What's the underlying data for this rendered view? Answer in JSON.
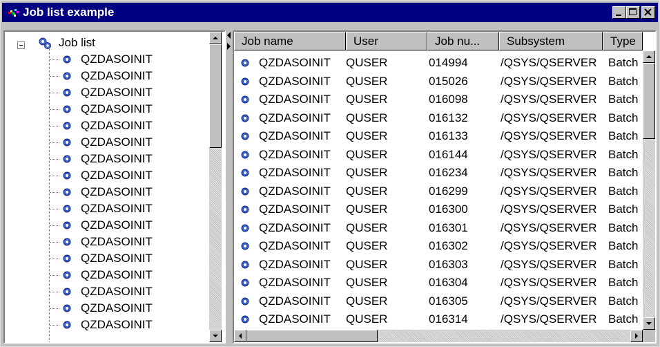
{
  "window": {
    "title": "Job list example",
    "title_bar_color": "#000080"
  },
  "title_buttons": [
    "minimize",
    "maximize",
    "close"
  ],
  "tree": {
    "root_label": "Job list",
    "items": [
      "QZDASOINIT",
      "QZDASOINIT",
      "QZDASOINIT",
      "QZDASOINIT",
      "QZDASOINIT",
      "QZDASOINIT",
      "QZDASOINIT",
      "QZDASOINIT",
      "QZDASOINIT",
      "QZDASOINIT",
      "QZDASOINIT",
      "QZDASOINIT",
      "QZDASOINIT",
      "QZDASOINIT",
      "QZDASOINIT",
      "QZDASOINIT",
      "QZDASOINIT"
    ]
  },
  "table": {
    "columns": [
      "Job name",
      "User",
      "Job nu...",
      "Subsystem",
      "Type"
    ],
    "rows": [
      [
        "QZDASOINIT",
        "QUSER",
        "014994",
        "/QSYS/QSERVER",
        "Batch"
      ],
      [
        "QZDASOINIT",
        "QUSER",
        "015026",
        "/QSYS/QSERVER",
        "Batch"
      ],
      [
        "QZDASOINIT",
        "QUSER",
        "016098",
        "/QSYS/QSERVER",
        "Batch"
      ],
      [
        "QZDASOINIT",
        "QUSER",
        "016132",
        "/QSYS/QSERVER",
        "Batch"
      ],
      [
        "QZDASOINIT",
        "QUSER",
        "016133",
        "/QSYS/QSERVER",
        "Batch"
      ],
      [
        "QZDASOINIT",
        "QUSER",
        "016144",
        "/QSYS/QSERVER",
        "Batch"
      ],
      [
        "QZDASOINIT",
        "QUSER",
        "016234",
        "/QSYS/QSERVER",
        "Batch"
      ],
      [
        "QZDASOINIT",
        "QUSER",
        "016299",
        "/QSYS/QSERVER",
        "Batch"
      ],
      [
        "QZDASOINIT",
        "QUSER",
        "016300",
        "/QSYS/QSERVER",
        "Batch"
      ],
      [
        "QZDASOINIT",
        "QUSER",
        "016301",
        "/QSYS/QSERVER",
        "Batch"
      ],
      [
        "QZDASOINIT",
        "QUSER",
        "016302",
        "/QSYS/QSERVER",
        "Batch"
      ],
      [
        "QZDASOINIT",
        "QUSER",
        "016303",
        "/QSYS/QSERVER",
        "Batch"
      ],
      [
        "QZDASOINIT",
        "QUSER",
        "016304",
        "/QSYS/QSERVER",
        "Batch"
      ],
      [
        "QZDASOINIT",
        "QUSER",
        "016305",
        "/QSYS/QSERVER",
        "Batch"
      ],
      [
        "QZDASOINIT",
        "QUSER",
        "016314",
        "/QSYS/QSERVER",
        "Batch"
      ]
    ]
  },
  "icons": {
    "root": "gears-icon",
    "job": "job-gear-icon"
  }
}
